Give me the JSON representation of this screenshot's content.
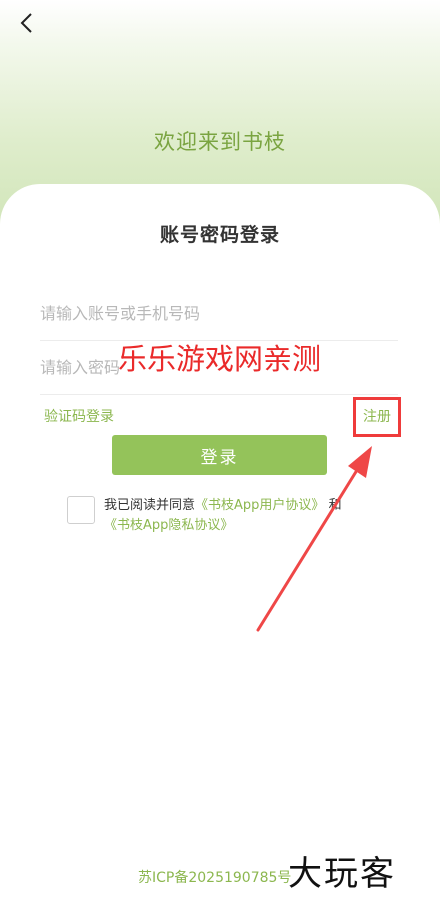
{
  "header": {
    "welcome": "欢迎来到书枝"
  },
  "form": {
    "title": "账号密码登录",
    "account_placeholder": "请输入账号或手机号码",
    "password_placeholder": "请输入密码",
    "sms_login": "验证码登录",
    "register": "注册",
    "login_button": "登录"
  },
  "agreement": {
    "prefix": "我已阅读并同意",
    "user_agreement": "《书枝App用户协议》",
    "and": "和",
    "privacy_policy": "《书枝App隐私协议》",
    "checked": false
  },
  "footer": {
    "icp": "苏ICP备2025190785号"
  },
  "overlay": {
    "watermark_text": "乐乐游戏网亲测",
    "logo_text": "大玩客"
  },
  "colors": {
    "accent_green": "#8cb74f",
    "button_green": "#94c35a",
    "annotation_red": "#ef3b3b"
  },
  "icons": {
    "back": "chevron-left-icon"
  }
}
